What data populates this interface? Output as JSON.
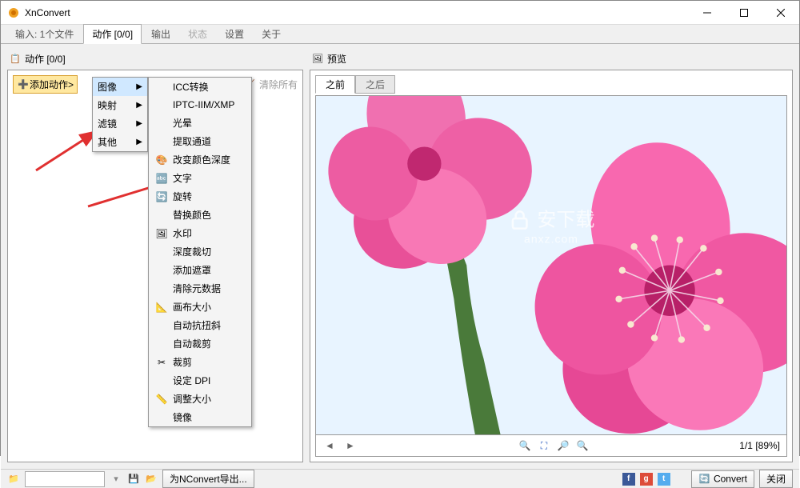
{
  "window": {
    "title": "XnConvert"
  },
  "tabs": {
    "input": "输入: 1个文件",
    "action": "动作 [0/0]",
    "output": "输出",
    "status": "状态",
    "settings": "设置",
    "about": "关于"
  },
  "left": {
    "header": "动作 [0/0]",
    "add_action": "添加动作>",
    "clear_all": "清除所有"
  },
  "menu1": {
    "image": "图像",
    "map": "映射",
    "filter": "滤镜",
    "other": "其他"
  },
  "menu2": {
    "items": [
      "ICC转换",
      "IPTC-IIM/XMP",
      "光晕",
      "提取通道",
      "改变颜色深度",
      "文字",
      "旋转",
      "替换颜色",
      "水印",
      "深度裁切",
      "添加遮罩",
      "清除元数据",
      "画布大小",
      "自动抗扭斜",
      "自动裁剪",
      "裁剪",
      "设定 DPI",
      "调整大小",
      "镜像"
    ]
  },
  "preview": {
    "title": "预览",
    "before": "之前",
    "after": "之后",
    "page_info": "1/1 [89%]"
  },
  "footer": {
    "export": "为NConvert导出...",
    "convert": "Convert",
    "close": "关闭"
  },
  "watermark": {
    "main": "安下载",
    "sub": "anxz.com"
  }
}
